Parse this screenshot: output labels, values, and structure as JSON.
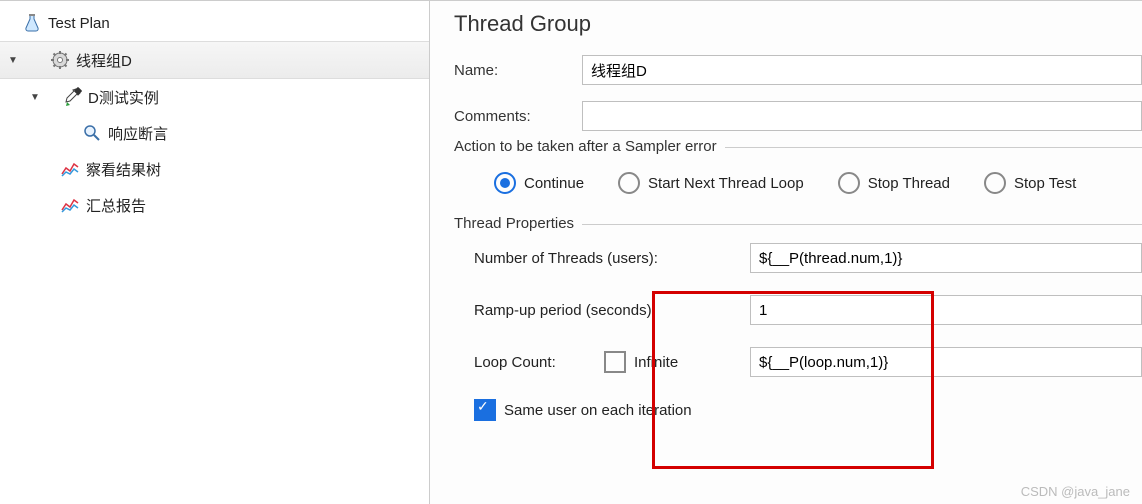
{
  "tree": {
    "test_plan": "Test Plan",
    "thread_group": "线程组D",
    "sampler": "D测试实例",
    "assertion": "响应断言",
    "view_results": "察看结果树",
    "summary_report": "汇总报告"
  },
  "panel": {
    "title": "Thread Group",
    "name_label": "Name:",
    "name_value": "线程组D",
    "comments_label": "Comments:",
    "comments_value": "",
    "error_legend": "Action to be taken after a Sampler error",
    "radio_continue": "Continue",
    "radio_start_next": "Start Next Thread Loop",
    "radio_stop_thread": "Stop Thread",
    "radio_stop_test": "Stop Test",
    "tp_legend": "Thread Properties",
    "num_threads_label": "Number of Threads (users):",
    "num_threads_value": "${__P(thread.num,1)}",
    "rampup_label": "Ramp-up period (seconds):",
    "rampup_value": "1",
    "loop_label": "Loop Count:",
    "loop_infinite": "Infinite",
    "loop_value": "${__P(loop.num,1)}",
    "same_user": "Same user on each iteration"
  },
  "watermark": "CSDN @java_jane"
}
